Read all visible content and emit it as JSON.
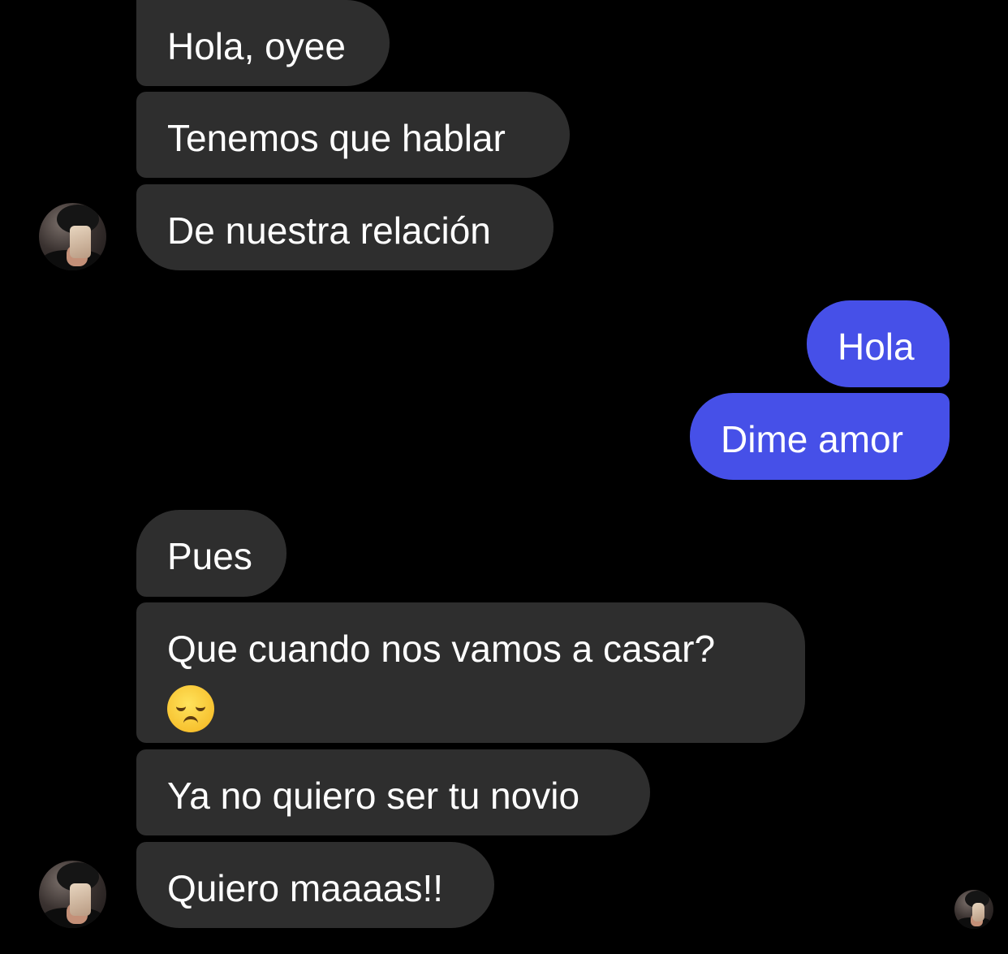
{
  "conversation": {
    "messages": [
      {
        "id": "m1",
        "sender": "contact",
        "text": "Hola, oyee"
      },
      {
        "id": "m2",
        "sender": "contact",
        "text": "Tenemos que hablar"
      },
      {
        "id": "m3",
        "sender": "contact",
        "text": "De nuestra relación"
      },
      {
        "id": "m4",
        "sender": "me",
        "text": "Hola"
      },
      {
        "id": "m5",
        "sender": "me",
        "text": "Dime amor"
      },
      {
        "id": "m6",
        "sender": "contact",
        "text": "Pues"
      },
      {
        "id": "m7",
        "sender": "contact",
        "text": "Que cuando nos vamos a casar?",
        "emoji": "disappointed-face-emoji"
      },
      {
        "id": "m8",
        "sender": "contact",
        "text": "Ya no quiero ser tu novio"
      },
      {
        "id": "m9",
        "sender": "contact",
        "text": "Quiero maaaas!!"
      }
    ]
  },
  "colors": {
    "background": "#000000",
    "incoming_bubble": "#2e2e2e",
    "outgoing_bubble": "#4650e8",
    "text": "#ffffff"
  }
}
